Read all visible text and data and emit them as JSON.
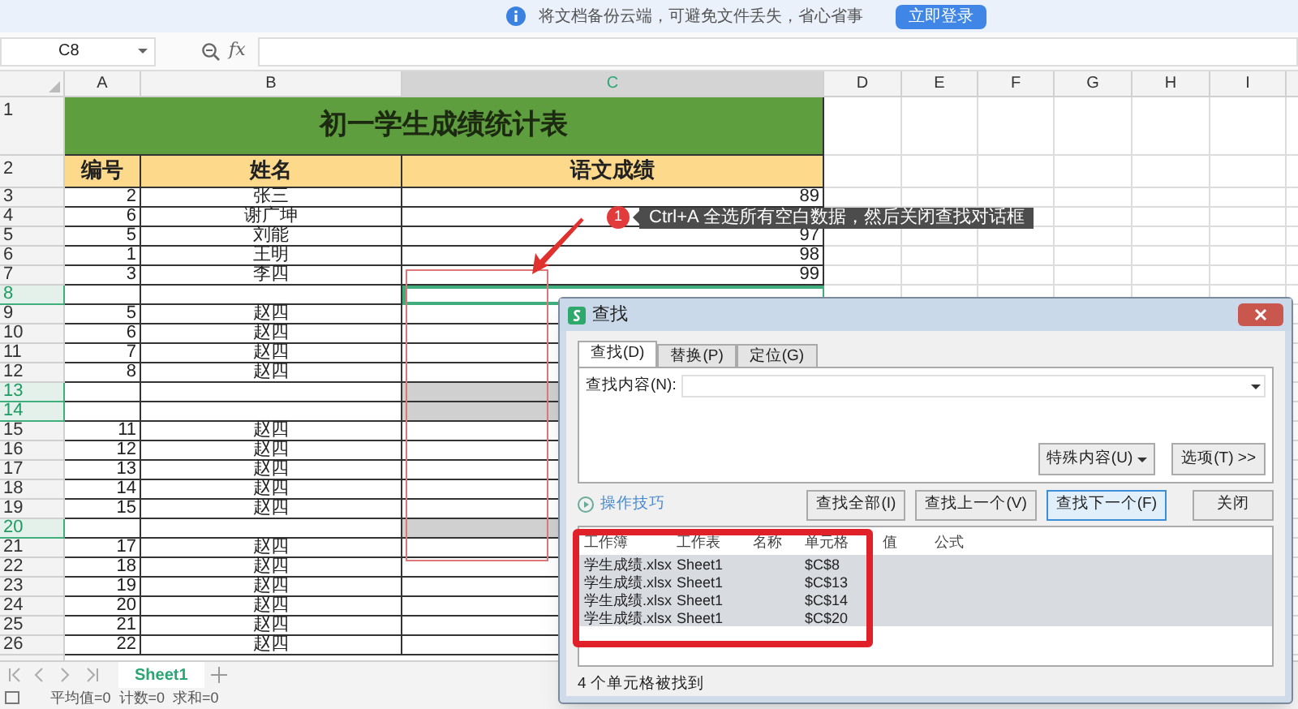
{
  "banner": {
    "message": "将文档备份云端，可避免文件丢失，省心省事",
    "button": "立即登录"
  },
  "formula_bar": {
    "name_box": "C8",
    "fx": "fx"
  },
  "columns": [
    {
      "label": "A",
      "selected": false
    },
    {
      "label": "B",
      "selected": false
    },
    {
      "label": "C",
      "selected": true
    },
    {
      "label": "D",
      "selected": false
    },
    {
      "label": "E",
      "selected": false
    },
    {
      "label": "F",
      "selected": false
    },
    {
      "label": "G",
      "selected": false
    },
    {
      "label": "H",
      "selected": false
    },
    {
      "label": "I",
      "selected": false
    }
  ],
  "title_row": {
    "row": "1",
    "title": "初一学生成绩统计表"
  },
  "header_row": {
    "row": "2",
    "cells": [
      "编号",
      "姓名",
      "语文成绩"
    ]
  },
  "rows": [
    {
      "row": "3",
      "id": "2",
      "name": "张三",
      "score": "89",
      "selected": false,
      "found": false,
      "active": false
    },
    {
      "row": "4",
      "id": "6",
      "name": "谢广坤",
      "selected": false,
      "found": false,
      "active": false
    },
    {
      "row": "5",
      "id": "5",
      "name": "刘能",
      "score": "97",
      "selected": false,
      "found": false,
      "active": false
    },
    {
      "row": "6",
      "id": "1",
      "name": "王明",
      "score": "98",
      "selected": false,
      "found": false,
      "active": false
    },
    {
      "row": "7",
      "id": "3",
      "name": "李四",
      "score": "99",
      "selected": false,
      "found": false,
      "active": false
    },
    {
      "row": "8",
      "selected": true,
      "found": false,
      "active": true
    },
    {
      "row": "9",
      "id": "5",
      "name": "赵四",
      "selected": false,
      "found": false,
      "active": false
    },
    {
      "row": "10",
      "id": "6",
      "name": "赵四",
      "selected": false,
      "found": false,
      "active": false
    },
    {
      "row": "11",
      "id": "7",
      "name": "赵四",
      "selected": false,
      "found": false,
      "active": false
    },
    {
      "row": "12",
      "id": "8",
      "name": "赵四",
      "selected": false,
      "found": false,
      "active": false
    },
    {
      "row": "13",
      "selected": true,
      "found": true,
      "active": false
    },
    {
      "row": "14",
      "selected": true,
      "found": true,
      "active": false
    },
    {
      "row": "15",
      "id": "11",
      "name": "赵四",
      "selected": false,
      "found": false,
      "active": false
    },
    {
      "row": "16",
      "id": "12",
      "name": "赵四",
      "selected": false,
      "found": false,
      "active": false
    },
    {
      "row": "17",
      "id": "13",
      "name": "赵四",
      "selected": false,
      "found": false,
      "active": false
    },
    {
      "row": "18",
      "id": "14",
      "name": "赵四",
      "selected": false,
      "found": false,
      "active": false
    },
    {
      "row": "19",
      "id": "15",
      "name": "赵四",
      "selected": false,
      "found": false,
      "active": false
    },
    {
      "row": "20",
      "selected": true,
      "found": true,
      "active": false
    },
    {
      "row": "21",
      "id": "17",
      "name": "赵四",
      "selected": false,
      "found": false,
      "active": false
    },
    {
      "row": "22",
      "id": "18",
      "name": "赵四",
      "selected": false,
      "found": false,
      "active": false
    },
    {
      "row": "23",
      "id": "19",
      "name": "赵四",
      "selected": false,
      "found": false,
      "active": false
    },
    {
      "row": "24",
      "id": "20",
      "name": "赵四",
      "selected": false,
      "found": false,
      "active": false
    },
    {
      "row": "25",
      "id": "21",
      "name": "赵四",
      "selected": false,
      "found": false,
      "active": false
    },
    {
      "row": "26",
      "id": "22",
      "name": "赵四",
      "selected": false,
      "found": false,
      "active": false
    }
  ],
  "tooltip": {
    "badge": "1",
    "text": "Ctrl+A 全选所有空白数据，然后关闭查找对话框"
  },
  "dialog": {
    "title": "查找",
    "tabs": [
      {
        "label": "查找(D)",
        "selected": true
      },
      {
        "label": "替换(P)",
        "selected": false
      },
      {
        "label": "定位(G)",
        "selected": false
      }
    ],
    "find_label": "查找内容(N):",
    "option_buttons": [
      "特殊内容(U)",
      "选项(T) >>"
    ],
    "tips_link": "操作技巧",
    "buttons": [
      {
        "label": "查找全部(I)",
        "focused": false
      },
      {
        "label": "查找上一个(V)",
        "focused": false
      },
      {
        "label": "查找下一个(F)",
        "focused": true
      },
      {
        "label": "关闭",
        "focused": false
      }
    ],
    "results": {
      "columns": [
        "工作簿",
        "工作表",
        "名称",
        "单元格",
        "值",
        "公式"
      ],
      "rows": [
        {
          "workbook": "学生成绩.xlsx",
          "sheet": "Sheet1",
          "cell": "$C$8",
          "selected": true
        },
        {
          "workbook": "学生成绩.xlsx",
          "sheet": "Sheet1",
          "cell": "$C$13",
          "selected": true
        },
        {
          "workbook": "学生成绩.xlsx",
          "sheet": "Sheet1",
          "cell": "$C$14",
          "selected": true
        },
        {
          "workbook": "学生成绩.xlsx",
          "sheet": "Sheet1",
          "cell": "$C$20",
          "selected": true
        }
      ]
    },
    "status": "4 个单元格被找到"
  },
  "sheet_tabs": [
    {
      "label": "Sheet1",
      "selected": true
    }
  ],
  "status_bar": {
    "items": [
      "平均值=0",
      "计数=0",
      "求和=0"
    ]
  }
}
